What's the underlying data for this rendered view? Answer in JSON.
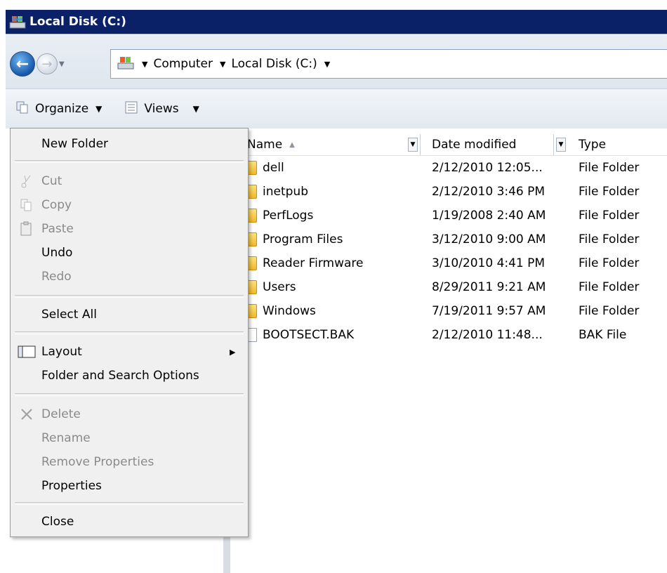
{
  "window": {
    "title": "Local Disk (C:)"
  },
  "address": {
    "breadcrumbs": [
      "Computer",
      "Local Disk (C:)"
    ]
  },
  "toolbar": {
    "organize_label": "Organize",
    "views_label": "Views"
  },
  "columns": {
    "name": "Name",
    "date": "Date modified",
    "type": "Type"
  },
  "files": [
    {
      "name": "dell",
      "date": "2/12/2010 12:05...",
      "type": "File Folder",
      "icon": "folder-icon"
    },
    {
      "name": "inetpub",
      "date": "2/12/2010 3:46 PM",
      "type": "File Folder",
      "icon": "folder-icon"
    },
    {
      "name": "PerfLogs",
      "date": "1/19/2008 2:40 AM",
      "type": "File Folder",
      "icon": "folder-icon"
    },
    {
      "name": "Program Files",
      "date": "3/12/2010 9:00 AM",
      "type": "File Folder",
      "icon": "folder-icon"
    },
    {
      "name": "Reader Firmware",
      "date": "3/10/2010 4:41 PM",
      "type": "File Folder",
      "icon": "folder-icon"
    },
    {
      "name": "Users",
      "date": "8/29/2011 9:21 AM",
      "type": "File Folder",
      "icon": "folder-icon"
    },
    {
      "name": "Windows",
      "date": "7/19/2011 9:57 AM",
      "type": "File Folder",
      "icon": "folder-icon"
    },
    {
      "name": "BOOTSECT.BAK",
      "date": "2/12/2010 11:48...",
      "type": "BAK File",
      "icon": "file-icon"
    }
  ],
  "menu": {
    "new_folder": "New Folder",
    "cut": "Cut",
    "copy": "Copy",
    "paste": "Paste",
    "undo": "Undo",
    "redo": "Redo",
    "select_all": "Select All",
    "layout": "Layout",
    "folder_options": "Folder and Search Options",
    "delete": "Delete",
    "rename": "Rename",
    "remove_properties": "Remove Properties",
    "properties": "Properties",
    "close": "Close"
  },
  "colors": {
    "title_bar": "#0b2167",
    "menu_bg": "#f0f0f0",
    "disabled_text": "#8a8a8a"
  }
}
